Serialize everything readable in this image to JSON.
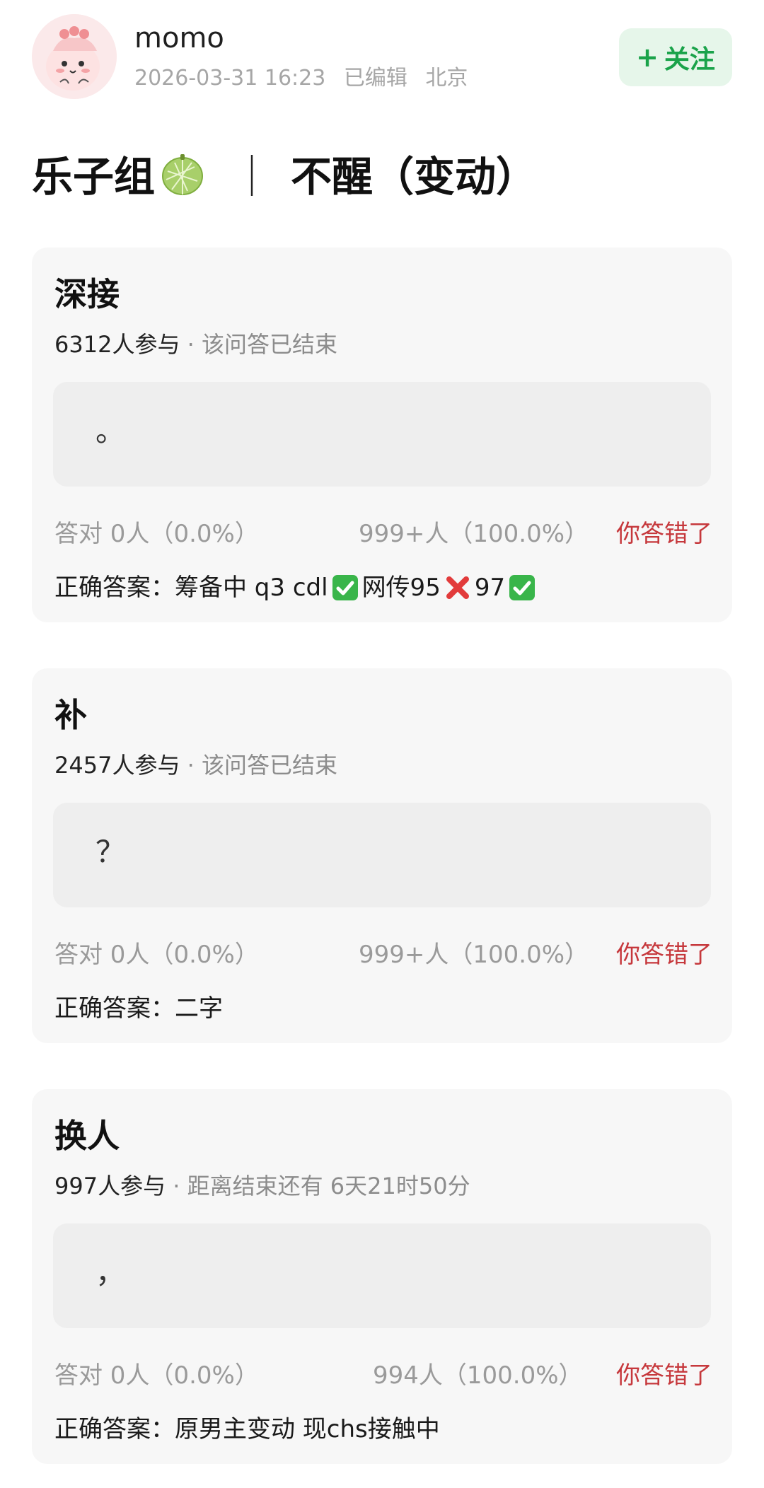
{
  "header": {
    "username": "momo",
    "datetime": "2026-03-31 16:23",
    "edited": "已编辑",
    "location": "北京",
    "follow_label": "关注",
    "follow_icon": "plus-icon",
    "colors": {
      "follow_bg": "#e6f6ea",
      "follow_text": "#1aa34a"
    }
  },
  "title": {
    "left": "乐子组",
    "emoji": "melon-icon",
    "separator": "｜",
    "right": "不醒（变动）"
  },
  "colors": {
    "wrong_answer": "#c6383c",
    "muted": "#9a9a9a"
  },
  "cards": [
    {
      "question": "深接",
      "participants": "6312人参与",
      "status": "· 该问答已结束",
      "answer": "。",
      "correct_stat": "答对  0人（0.0%）",
      "wrong_stat": "999+人（100.0%）",
      "result": "你答错了",
      "correct_answer_label": "正确答案：",
      "correct_answer_parts": [
        "筹备中 q3 cdl",
        "check",
        " 网传95",
        "cross",
        "97",
        "check"
      ]
    },
    {
      "question": "补",
      "participants": "2457人参与",
      "status": "· 该问答已结束",
      "answer": "？",
      "correct_stat": "答对  0人（0.0%）",
      "wrong_stat": "999+人（100.0%）",
      "result": "你答错了",
      "correct_answer_label": "正确答案：",
      "correct_answer_parts": [
        "二字"
      ]
    },
    {
      "question": "换人",
      "participants": "997人参与",
      "status": "· 距离结束还有 6天21时50分",
      "answer": "，",
      "correct_stat": "答对  0人（0.0%）",
      "wrong_stat": "994人（100.0%）",
      "result": "你答错了",
      "correct_answer_label": "正确答案：",
      "correct_answer_parts": [
        "原男主变动 现chs接触中"
      ]
    }
  ]
}
